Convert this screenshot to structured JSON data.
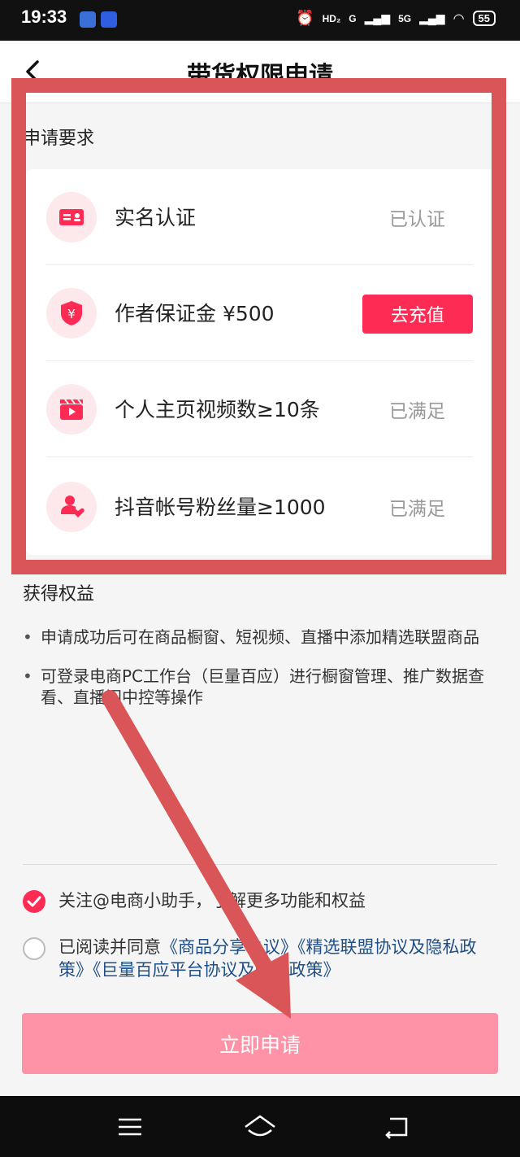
{
  "status_bar": {
    "time": "19:33",
    "hd_label": "HD₂",
    "signal_labels": [
      "G",
      "5G"
    ],
    "battery": "55"
  },
  "header": {
    "title": "带货权限申请"
  },
  "requirements": {
    "section_title": "申请要求",
    "items": [
      {
        "icon": "id-card-icon",
        "label": "实名认证",
        "status": "已认证"
      },
      {
        "icon": "yuan-shield-icon",
        "label": "作者保证金 ¥500",
        "action": "去充值"
      },
      {
        "icon": "video-clapper-icon",
        "label": "个人主页视频数≥10条",
        "status": "已满足"
      },
      {
        "icon": "fans-heart-icon",
        "label": "抖音帐号粉丝量≥1000",
        "status": "已满足"
      }
    ]
  },
  "privileges": {
    "section_title": "获得权益",
    "notes": [
      "申请成功后可在商品橱窗、短视频、直播中添加精选联盟商品",
      "可登录电商PC工作台（巨量百应）进行橱窗管理、推广数据查看、直播间中控等操作"
    ]
  },
  "options": {
    "follow_text": "关注@电商小助手，了解更多功能和权益",
    "agree_prefix": "已阅读并同意",
    "agree_links": [
      "《商品分享协议》",
      "《精选联盟协议及隐私政策》",
      "《巨量百应平台协议及隐私政策》"
    ]
  },
  "submit_label": "立即申请",
  "colors": {
    "accent": "#fe2c55",
    "submit_disabled": "#fe93a8",
    "annotation": "#d95557",
    "link": "#1f4f86"
  }
}
